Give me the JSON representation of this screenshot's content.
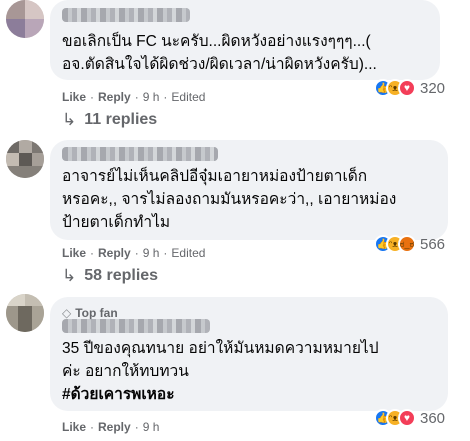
{
  "comments": [
    {
      "text_lines": [
        "ขอเลิกเป็น FC นะครับ...ผิดหวังอย่างแรงๆๆๆ...(",
        "อจ.ตัดสินใจได้ผิดช่วง/ผิดเวลา/น่าผิดหวังครับ)..."
      ],
      "like_label": "Like",
      "reply_label": "Reply",
      "time": "9 h",
      "edited": "Edited",
      "reaction_count": "320",
      "reactions": [
        "like",
        "haha",
        "love"
      ],
      "replies_label": "11 replies"
    },
    {
      "text_lines": [
        "อาจารย์ไม่เห็นคลิปอีจุ๋มเอายาหม่องป้ายตาเด็ก",
        "หรอคะ,, จารไม่ลองถามมันหรอคะว่า,, เอายาหม่อง",
        "ป้ายตาเด็กทำไม"
      ],
      "like_label": "Like",
      "reply_label": "Reply",
      "time": "9 h",
      "edited": "Edited",
      "reaction_count": "566",
      "reactions": [
        "like",
        "haha",
        "angry"
      ],
      "replies_label": "58 replies"
    },
    {
      "badge": "Top fan",
      "text_lines": [
        "35 ปีของคุณทนาย อย่าให้มันหมดความหมายไป",
        "ค่ะ อยากให้ทบทวน"
      ],
      "hashtag": "#ด้วยเคารพเหอะ",
      "like_label": "Like",
      "reply_label": "Reply",
      "time": "9 h",
      "reaction_count": "360",
      "reactions": [
        "like",
        "haha",
        "love"
      ]
    }
  ],
  "icons": {
    "reply_arrow": "reply-arrow-icon",
    "top_fan": "diamond-icon"
  },
  "colors": {
    "bubble": "#f0f2f5",
    "meta_text": "#65676b",
    "like_blue": "#1877f2",
    "haha_yellow": "#f7b125",
    "love_red": "#f33e58",
    "angry_orange": "#e9710f"
  }
}
